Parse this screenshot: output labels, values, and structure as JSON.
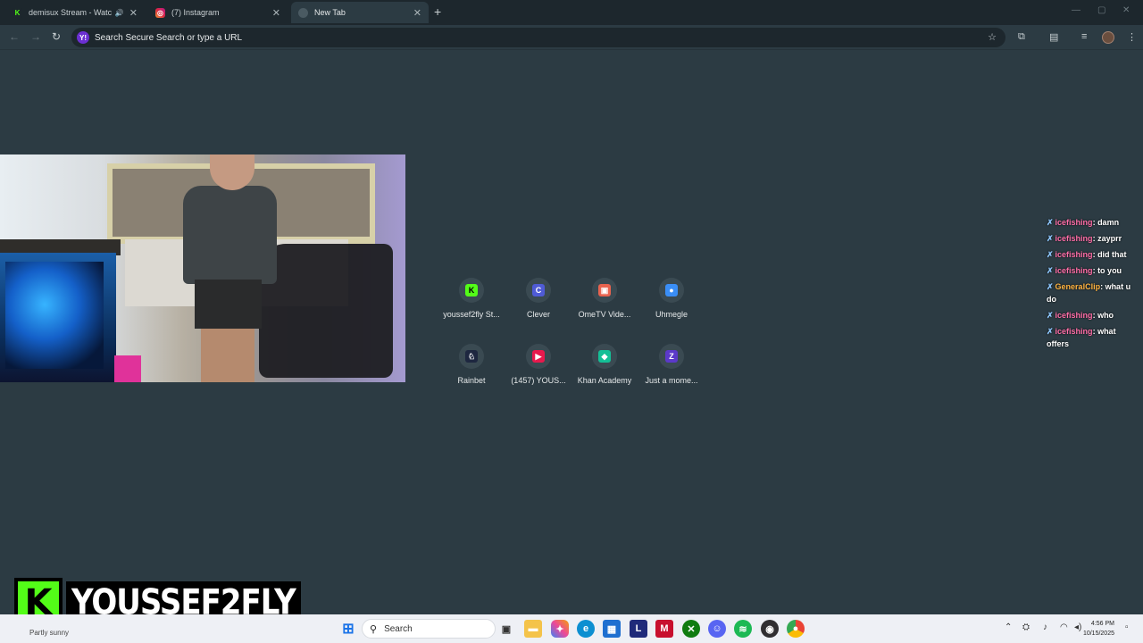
{
  "tabs": [
    {
      "title": "demisux Stream - Watch Li",
      "favicon": "kick-icon",
      "audio": true
    },
    {
      "title": "(7) Instagram",
      "favicon": "instagram-icon"
    },
    {
      "title": "New Tab",
      "favicon": "newtab-icon",
      "active": true
    }
  ],
  "omnibox": {
    "placeholder": "Search Secure Search or type a URL",
    "engine_icon": "Y!"
  },
  "shortcuts": [
    {
      "label": "youssef2fly St...",
      "icon": "kick-icon",
      "color": "#53fc18",
      "glyph": "K"
    },
    {
      "label": "Clever",
      "icon": "clever-icon",
      "color": "#4f5bd5",
      "glyph": "C"
    },
    {
      "label": "OmeTV Vide...",
      "icon": "ometv-icon",
      "color": "#e8634f",
      "glyph": "▣"
    },
    {
      "label": "Uhmegle",
      "icon": "chat-bubble-icon",
      "color": "#3a8ef6",
      "glyph": "●"
    },
    {
      "label": "Rainbet",
      "icon": "rainbet-icon",
      "color": "#1e2740",
      "glyph": "♘"
    },
    {
      "label": "(1457) YOUS...",
      "icon": "youtube-icon",
      "color": "#e8194d",
      "glyph": "▶"
    },
    {
      "label": "Khan Academy",
      "icon": "khan-academy-icon",
      "color": "#14bf96",
      "glyph": "◆"
    },
    {
      "label": "Just a mome...",
      "icon": "cloudflare-icon",
      "color": "#5b39c9",
      "glyph": "Z"
    }
  ],
  "chat": [
    {
      "user": "icefishing",
      "text": "damn",
      "color": "#ff6ea8"
    },
    {
      "user": "icefishing",
      "text": "zayprr",
      "color": "#ff6ea8"
    },
    {
      "user": "icefishing",
      "text": "did that",
      "color": "#ff6ea8"
    },
    {
      "user": "icefishing",
      "text": "to you",
      "color": "#ff6ea8"
    },
    {
      "user": "GeneralClip",
      "text": "what u do",
      "color": "#ffb340"
    },
    {
      "user": "icefishing",
      "text": "who",
      "color": "#ff6ea8"
    },
    {
      "user": "icefishing",
      "text": "what offers",
      "color": "#ff6ea8"
    }
  ],
  "overlay": {
    "logo_letter": "K",
    "streamer": "YOUSSEF2FLY"
  },
  "taskbar": {
    "weather": "Partly sunny",
    "search_placeholder": "Search",
    "time": "4:56 PM",
    "date": "10/15/2025"
  }
}
